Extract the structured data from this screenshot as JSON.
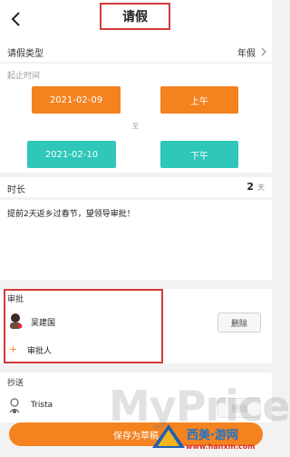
{
  "header": {
    "title": "请假"
  },
  "leave_type": {
    "label": "请假类型",
    "value": "年假",
    "chevron": "chevron-right-icon"
  },
  "period": {
    "label": "起止时间",
    "start_date": "2021-02-09",
    "start_half": "上午",
    "separator": "至",
    "end_date": "2021-02-10",
    "end_half": "下午"
  },
  "duration": {
    "label": "时长",
    "value": "2",
    "unit": "天"
  },
  "reason": {
    "text": "提前2天返乡过春节，望领导审批！"
  },
  "approval": {
    "section_label": "审批",
    "approver_name": "吴建国",
    "delete_label": "删除",
    "add_label": "审批人"
  },
  "cc": {
    "section_label": "抄送",
    "person_name": "Trista",
    "delete_label": "删除"
  },
  "footer": {
    "save_label": "保存为草稿"
  },
  "watermark": {
    "brand": "MyPrice",
    "site": "西美·游网",
    "url": "www.hanxm.com"
  },
  "colors": {
    "accent": "#f4821f",
    "teal": "#2ec7b9",
    "highlight": "#d23b3b"
  }
}
